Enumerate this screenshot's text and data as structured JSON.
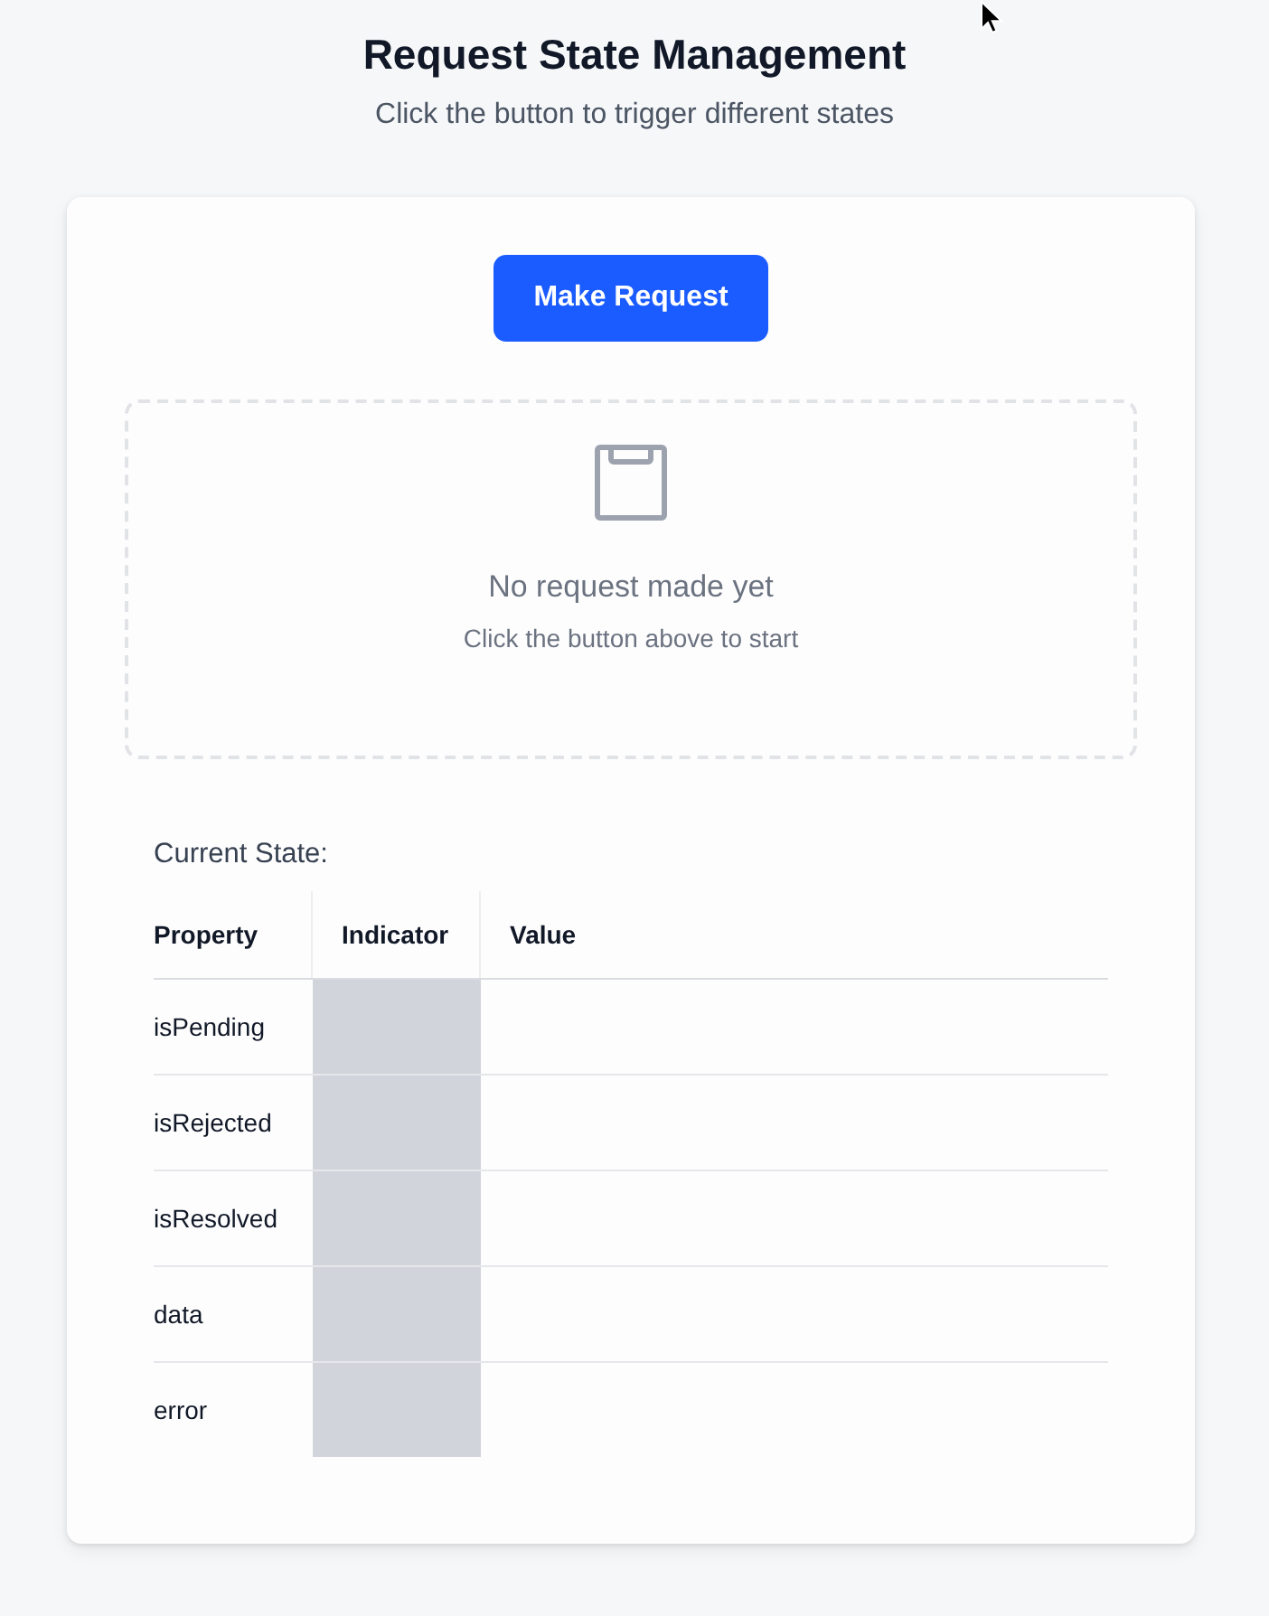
{
  "header": {
    "title": "Request State Management",
    "subtitle": "Click the button to trigger different states"
  },
  "request_button": {
    "label": "Make Request"
  },
  "empty_state": {
    "title": "No request made yet",
    "hint": "Click the button above to start"
  },
  "state_table": {
    "caption": "Current State:",
    "columns": [
      "Property",
      "Indicator",
      "Value"
    ],
    "rows": [
      {
        "property": "isPending",
        "active": false
      },
      {
        "property": "isRejected",
        "active": false
      },
      {
        "property": "isResolved",
        "active": false
      },
      {
        "property": "data",
        "active": false
      },
      {
        "property": "error",
        "active": false
      }
    ]
  }
}
